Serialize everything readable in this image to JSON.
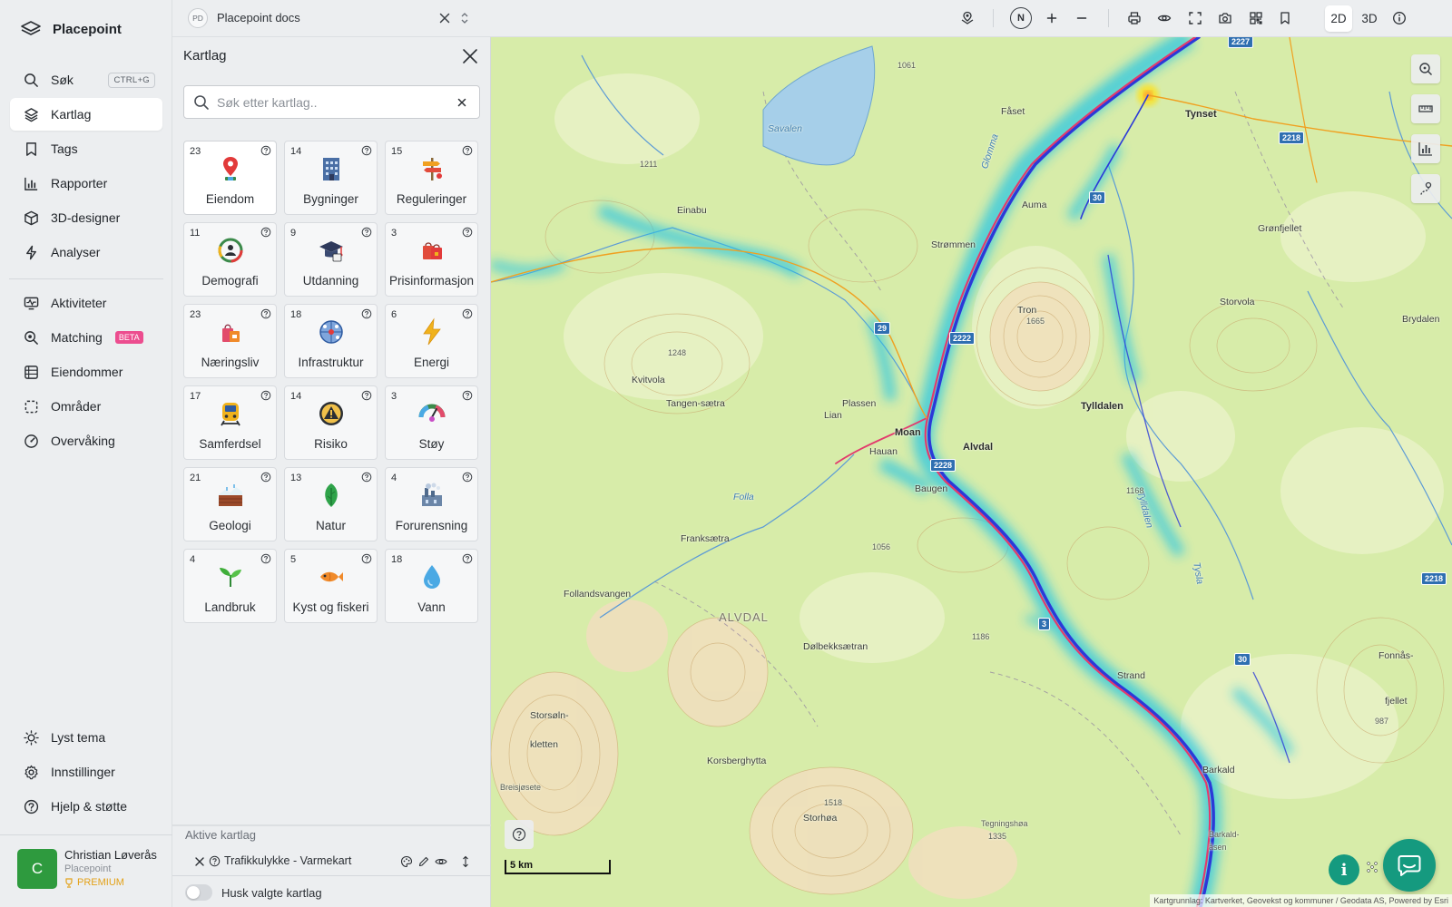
{
  "app": {
    "name": "Placepoint"
  },
  "sidebar": {
    "items": [
      {
        "label": "Søk",
        "shortcut": "CTRL+G",
        "icon": "search-icon"
      },
      {
        "label": "Kartlag",
        "icon": "layers-icon",
        "active": true
      },
      {
        "label": "Tags",
        "icon": "bookmark-icon"
      },
      {
        "label": "Rapporter",
        "icon": "bar-chart-icon"
      },
      {
        "label": "3D-designer",
        "icon": "cube-icon"
      },
      {
        "label": "Analyser",
        "icon": "lightning-icon"
      },
      {
        "label": "Aktiviteter",
        "icon": "activity-monitor-icon"
      },
      {
        "label": "Matching",
        "badge": "BETA",
        "icon": "magnify-match-icon"
      },
      {
        "label": "Eiendommer",
        "icon": "building-icon"
      },
      {
        "label": "Områder",
        "icon": "dashed-square-icon"
      },
      {
        "label": "Overvåking",
        "icon": "gauge-icon"
      }
    ],
    "bottom_items": [
      {
        "label": "Lyst tema",
        "icon": "sun-icon"
      },
      {
        "label": "Innstillinger",
        "icon": "gear-icon"
      },
      {
        "label": "Hjelp & støtte",
        "icon": "help-circle-icon"
      }
    ],
    "user": {
      "initial": "C",
      "name": "Christian Løverås",
      "org": "Placepoint",
      "plan": "PREMIUM"
    }
  },
  "topbar": {
    "doc_badge": "PD",
    "doc_title": "Placepoint docs",
    "north_label": "N",
    "view_2d": "2D",
    "view_3d": "3D",
    "active_view": "2D"
  },
  "panel": {
    "title": "Kartlag",
    "search_placeholder": "Søk etter kartlag..",
    "categories": [
      {
        "count": "23",
        "label": "Eiendom",
        "icon": "map-pin-icon",
        "selected": true
      },
      {
        "count": "14",
        "label": "Bygninger",
        "icon": "office-building-icon"
      },
      {
        "count": "15",
        "label": "Reguleringer",
        "icon": "signpost-icon"
      },
      {
        "count": "11",
        "label": "Demografi",
        "icon": "people-ring-icon"
      },
      {
        "count": "9",
        "label": "Utdanning",
        "icon": "graduation-cap-icon"
      },
      {
        "count": "3",
        "label": "Prisinformasjon",
        "icon": "shopping-bags-icon"
      },
      {
        "count": "23",
        "label": "Næringsliv",
        "icon": "shopping-bag-icon"
      },
      {
        "count": "18",
        "label": "Infrastruktur",
        "icon": "network-globe-icon"
      },
      {
        "count": "6",
        "label": "Energi",
        "icon": "lightning-bolt-icon"
      },
      {
        "count": "17",
        "label": "Samferdsel",
        "icon": "train-icon"
      },
      {
        "count": "14",
        "label": "Risiko",
        "icon": "warning-triangle-icon"
      },
      {
        "count": "3",
        "label": "Støy",
        "icon": "noise-meter-icon"
      },
      {
        "count": "21",
        "label": "Geologi",
        "icon": "terrain-layers-icon"
      },
      {
        "count": "13",
        "label": "Natur",
        "icon": "leaf-icon"
      },
      {
        "count": "4",
        "label": "Forurensning",
        "icon": "factory-icon"
      },
      {
        "count": "4",
        "label": "Landbruk",
        "icon": "sprout-icon"
      },
      {
        "count": "5",
        "label": "Kyst og fiskeri",
        "icon": "fish-icon"
      },
      {
        "count": "18",
        "label": "Vann",
        "icon": "water-drop-icon"
      }
    ],
    "active_title": "Aktive kartlag",
    "active_layers": [
      {
        "name": "Trafikkulykke - Varmekart"
      }
    ],
    "remember_label": "Husk valgte kartlag"
  },
  "map": {
    "scale_label": "5 km",
    "attribution": "Kartgrunnlag: Kartverket, Geovekst og kommuner / Geodata AS, Powered by Esri",
    "places": [
      {
        "name": "Tynset",
        "bold": true
      },
      {
        "name": "Fåset"
      },
      {
        "name": "Savalen"
      },
      {
        "name": "Einabu"
      },
      {
        "name": "Auma"
      },
      {
        "name": "Strømmen"
      },
      {
        "name": "Grønfjellet"
      },
      {
        "name": "Tron"
      },
      {
        "name": "Storvola"
      },
      {
        "name": "Brydalen"
      },
      {
        "name": "Kvitvola"
      },
      {
        "name": "Tangen-sætra"
      },
      {
        "name": "Plassen"
      },
      {
        "name": "Lian"
      },
      {
        "name": "Moan"
      },
      {
        "name": "Hauan"
      },
      {
        "name": "Alvdal",
        "bold": true
      },
      {
        "name": "Tylldalen"
      },
      {
        "name": "Baugen"
      },
      {
        "name": "Tylldalen"
      },
      {
        "name": "Folla"
      },
      {
        "name": "Franksætra"
      },
      {
        "name": "Follandsvangen"
      },
      {
        "name": "ALVDAL"
      },
      {
        "name": "Dølbekksætran"
      },
      {
        "name": "Strand"
      },
      {
        "name": "Fonnås-"
      },
      {
        "name": "fjellet"
      },
      {
        "name": "Storsøln-"
      },
      {
        "name": "kletten"
      },
      {
        "name": "Korsberghytta"
      },
      {
        "name": "Barkald"
      },
      {
        "name": "Breisjøsete"
      },
      {
        "name": "Storhøa"
      },
      {
        "name": "Tegningshøa"
      },
      {
        "name": "Barkald-"
      },
      {
        "name": "åsen"
      },
      {
        "name": "Glomma"
      },
      {
        "name": "Tysla"
      }
    ],
    "elevations": [
      "1061",
      "1211",
      "1665",
      "1248",
      "1056",
      "1186",
      "1518",
      "1335",
      "1168",
      "987"
    ],
    "road_numbers": [
      "2227",
      "2218",
      "30",
      "29",
      "2222",
      "2228",
      "3",
      "2218",
      "30"
    ]
  }
}
